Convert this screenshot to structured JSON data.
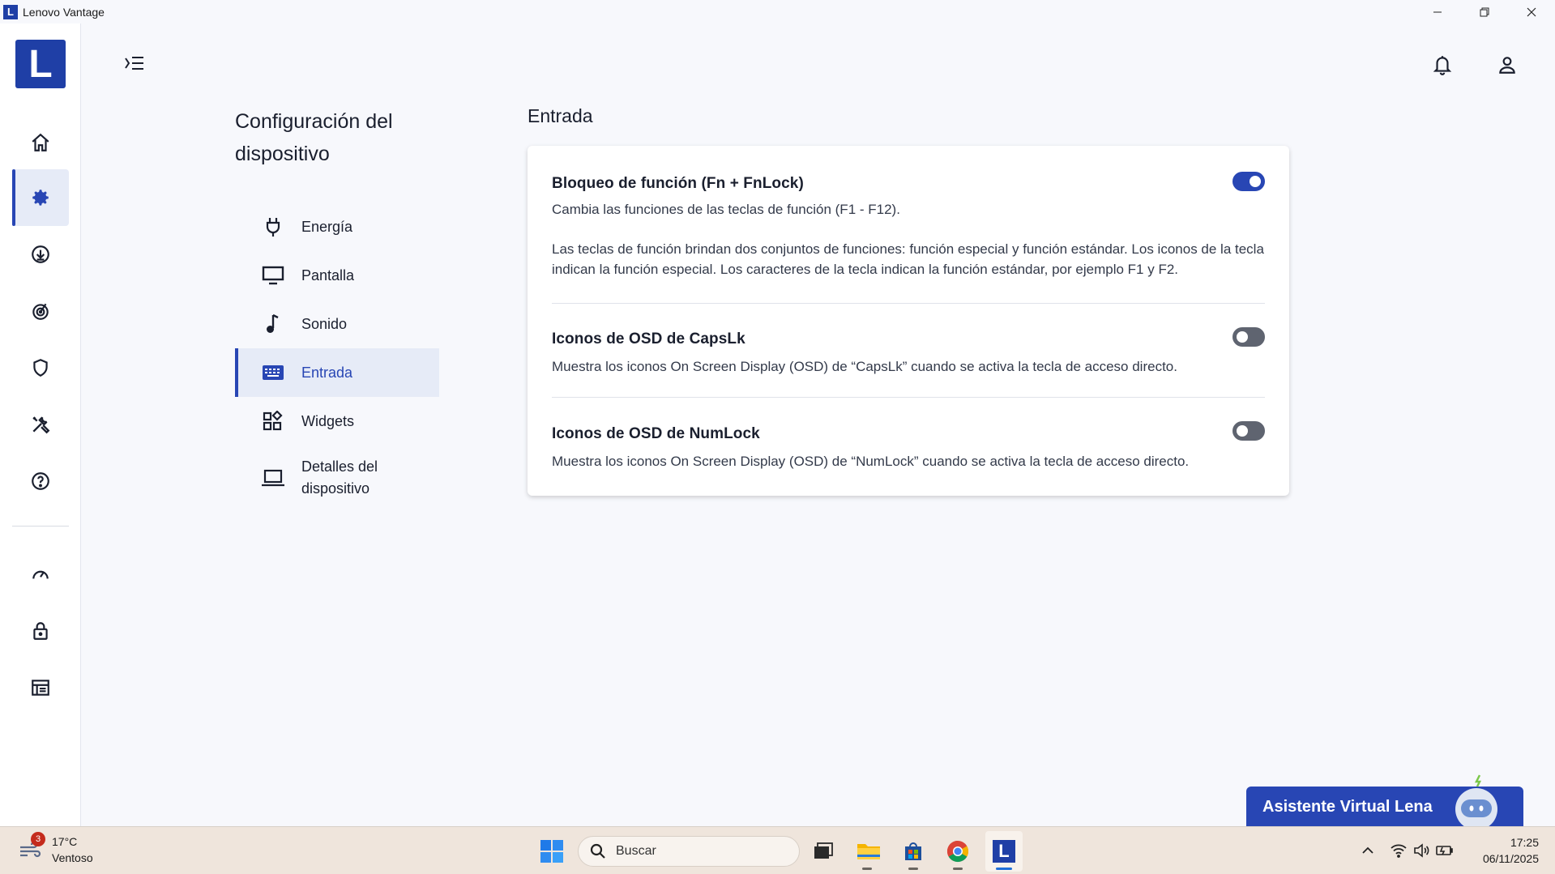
{
  "window": {
    "logo_letter": "L",
    "title": "Lenovo Vantage",
    "minimize": "—",
    "restore": "❐",
    "close": "✕"
  },
  "rail": {
    "logo_letter": "L",
    "items": [
      {
        "icon": "home-icon"
      },
      {
        "icon": "gear-icon",
        "active": true
      },
      {
        "icon": "download-icon"
      },
      {
        "icon": "radar-icon"
      },
      {
        "icon": "shield-icon"
      },
      {
        "icon": "tools-icon"
      },
      {
        "icon": "help-icon"
      },
      {
        "icon": "speedometer-icon"
      },
      {
        "icon": "lock-icon"
      },
      {
        "icon": "dashboard-icon"
      }
    ]
  },
  "section": {
    "title": "Configuración del dispositivo"
  },
  "subnav": {
    "items": [
      {
        "label": "Energía",
        "icon": "plug-icon"
      },
      {
        "label": "Pantalla",
        "icon": "monitor-icon"
      },
      {
        "label": "Sonido",
        "icon": "music-note-icon"
      },
      {
        "label": "Entrada",
        "icon": "keyboard-icon",
        "active": true
      },
      {
        "label": "Widgets",
        "icon": "widgets-icon"
      },
      {
        "label": "Detalles del dispositivo",
        "icon": "laptop-icon"
      }
    ]
  },
  "content": {
    "title": "Entrada",
    "settings": [
      {
        "title": "Bloqueo de función (Fn + FnLock)",
        "description": "Cambia las funciones de las teclas de función (F1 - F12).",
        "extra": "Las teclas de función brindan dos conjuntos de funciones: función especial y función estándar. Los iconos de la tecla indican la función especial. Los caracteres de la tecla indican la función estándar, por ejemplo F1 y F2.",
        "enabled": true
      },
      {
        "title": "Iconos de OSD de CapsLk",
        "description": "Muestra los iconos On Screen Display (OSD) de “CapsLk” cuando se activa la tecla de acceso directo.",
        "enabled": false
      },
      {
        "title": "Iconos de OSD de NumLock",
        "description": "Muestra los iconos On Screen Display (OSD) de “NumLock” cuando se activa la tecla de acceso directo.",
        "enabled": false
      }
    ]
  },
  "assistant": {
    "label": "Asistente Virtual Lena"
  },
  "taskbar": {
    "weather_badge": "3",
    "temperature": "17°C",
    "condition": "Ventoso",
    "search_placeholder": "Buscar",
    "time": "17:25",
    "date": "06/11/2025",
    "vantage_letter": "L"
  },
  "colors": {
    "accent": "#2846b4",
    "logo": "#1f3fa6",
    "background": "#f7f8fc",
    "taskbar": "#efe5dc"
  }
}
